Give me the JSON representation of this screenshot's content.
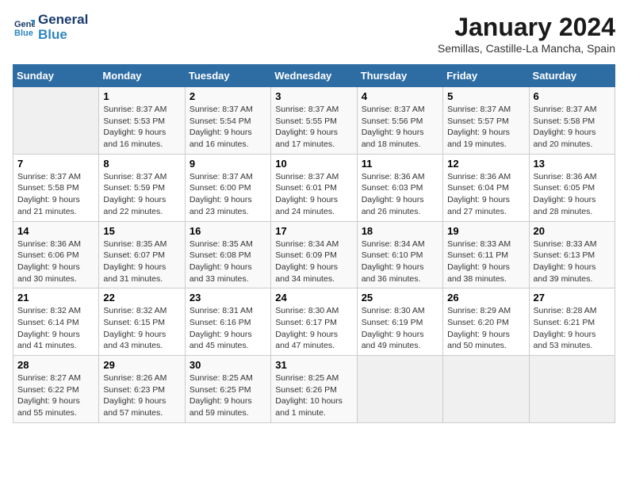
{
  "header": {
    "logo_line1": "General",
    "logo_line2": "Blue",
    "title": "January 2024",
    "subtitle": "Semillas, Castille-La Mancha, Spain"
  },
  "weekdays": [
    "Sunday",
    "Monday",
    "Tuesday",
    "Wednesday",
    "Thursday",
    "Friday",
    "Saturday"
  ],
  "weeks": [
    [
      {
        "day": "",
        "info": ""
      },
      {
        "day": "1",
        "info": "Sunrise: 8:37 AM\nSunset: 5:53 PM\nDaylight: 9 hours\nand 16 minutes."
      },
      {
        "day": "2",
        "info": "Sunrise: 8:37 AM\nSunset: 5:54 PM\nDaylight: 9 hours\nand 16 minutes."
      },
      {
        "day": "3",
        "info": "Sunrise: 8:37 AM\nSunset: 5:55 PM\nDaylight: 9 hours\nand 17 minutes."
      },
      {
        "day": "4",
        "info": "Sunrise: 8:37 AM\nSunset: 5:56 PM\nDaylight: 9 hours\nand 18 minutes."
      },
      {
        "day": "5",
        "info": "Sunrise: 8:37 AM\nSunset: 5:57 PM\nDaylight: 9 hours\nand 19 minutes."
      },
      {
        "day": "6",
        "info": "Sunrise: 8:37 AM\nSunset: 5:58 PM\nDaylight: 9 hours\nand 20 minutes."
      }
    ],
    [
      {
        "day": "7",
        "info": "Sunrise: 8:37 AM\nSunset: 5:58 PM\nDaylight: 9 hours\nand 21 minutes."
      },
      {
        "day": "8",
        "info": "Sunrise: 8:37 AM\nSunset: 5:59 PM\nDaylight: 9 hours\nand 22 minutes."
      },
      {
        "day": "9",
        "info": "Sunrise: 8:37 AM\nSunset: 6:00 PM\nDaylight: 9 hours\nand 23 minutes."
      },
      {
        "day": "10",
        "info": "Sunrise: 8:37 AM\nSunset: 6:01 PM\nDaylight: 9 hours\nand 24 minutes."
      },
      {
        "day": "11",
        "info": "Sunrise: 8:36 AM\nSunset: 6:03 PM\nDaylight: 9 hours\nand 26 minutes."
      },
      {
        "day": "12",
        "info": "Sunrise: 8:36 AM\nSunset: 6:04 PM\nDaylight: 9 hours\nand 27 minutes."
      },
      {
        "day": "13",
        "info": "Sunrise: 8:36 AM\nSunset: 6:05 PM\nDaylight: 9 hours\nand 28 minutes."
      }
    ],
    [
      {
        "day": "14",
        "info": "Sunrise: 8:36 AM\nSunset: 6:06 PM\nDaylight: 9 hours\nand 30 minutes."
      },
      {
        "day": "15",
        "info": "Sunrise: 8:35 AM\nSunset: 6:07 PM\nDaylight: 9 hours\nand 31 minutes."
      },
      {
        "day": "16",
        "info": "Sunrise: 8:35 AM\nSunset: 6:08 PM\nDaylight: 9 hours\nand 33 minutes."
      },
      {
        "day": "17",
        "info": "Sunrise: 8:34 AM\nSunset: 6:09 PM\nDaylight: 9 hours\nand 34 minutes."
      },
      {
        "day": "18",
        "info": "Sunrise: 8:34 AM\nSunset: 6:10 PM\nDaylight: 9 hours\nand 36 minutes."
      },
      {
        "day": "19",
        "info": "Sunrise: 8:33 AM\nSunset: 6:11 PM\nDaylight: 9 hours\nand 38 minutes."
      },
      {
        "day": "20",
        "info": "Sunrise: 8:33 AM\nSunset: 6:13 PM\nDaylight: 9 hours\nand 39 minutes."
      }
    ],
    [
      {
        "day": "21",
        "info": "Sunrise: 8:32 AM\nSunset: 6:14 PM\nDaylight: 9 hours\nand 41 minutes."
      },
      {
        "day": "22",
        "info": "Sunrise: 8:32 AM\nSunset: 6:15 PM\nDaylight: 9 hours\nand 43 minutes."
      },
      {
        "day": "23",
        "info": "Sunrise: 8:31 AM\nSunset: 6:16 PM\nDaylight: 9 hours\nand 45 minutes."
      },
      {
        "day": "24",
        "info": "Sunrise: 8:30 AM\nSunset: 6:17 PM\nDaylight: 9 hours\nand 47 minutes."
      },
      {
        "day": "25",
        "info": "Sunrise: 8:30 AM\nSunset: 6:19 PM\nDaylight: 9 hours\nand 49 minutes."
      },
      {
        "day": "26",
        "info": "Sunrise: 8:29 AM\nSunset: 6:20 PM\nDaylight: 9 hours\nand 50 minutes."
      },
      {
        "day": "27",
        "info": "Sunrise: 8:28 AM\nSunset: 6:21 PM\nDaylight: 9 hours\nand 53 minutes."
      }
    ],
    [
      {
        "day": "28",
        "info": "Sunrise: 8:27 AM\nSunset: 6:22 PM\nDaylight: 9 hours\nand 55 minutes."
      },
      {
        "day": "29",
        "info": "Sunrise: 8:26 AM\nSunset: 6:23 PM\nDaylight: 9 hours\nand 57 minutes."
      },
      {
        "day": "30",
        "info": "Sunrise: 8:25 AM\nSunset: 6:25 PM\nDaylight: 9 hours\nand 59 minutes."
      },
      {
        "day": "31",
        "info": "Sunrise: 8:25 AM\nSunset: 6:26 PM\nDaylight: 10 hours\nand 1 minute."
      },
      {
        "day": "",
        "info": ""
      },
      {
        "day": "",
        "info": ""
      },
      {
        "day": "",
        "info": ""
      }
    ]
  ]
}
